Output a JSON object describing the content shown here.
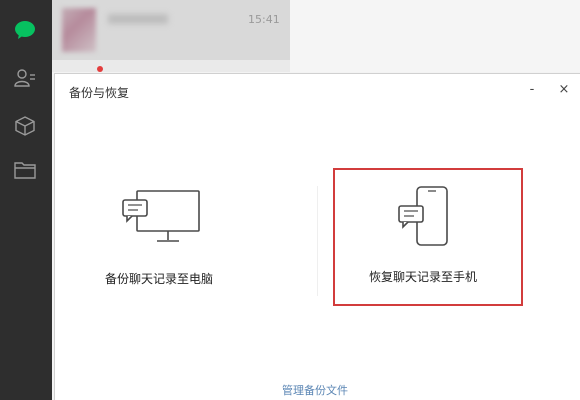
{
  "sidebar": {
    "icons": [
      "chat-bubble-icon",
      "contacts-icon",
      "box-icon",
      "folder-icon"
    ]
  },
  "chat_list": {
    "item": {
      "time": "15:41"
    }
  },
  "dialog": {
    "title": "备份与恢复",
    "minimize_label": "-",
    "close_label": "×",
    "backup_label": "备份聊天记录至电脑",
    "restore_label": "恢复聊天记录至手机",
    "manage_link": "管理备份文件"
  },
  "colors": {
    "sidebar_bg": "#2e2e2e",
    "active_green": "#07c160",
    "highlight_red": "#d23c3c",
    "link_blue": "#5b86b4"
  }
}
